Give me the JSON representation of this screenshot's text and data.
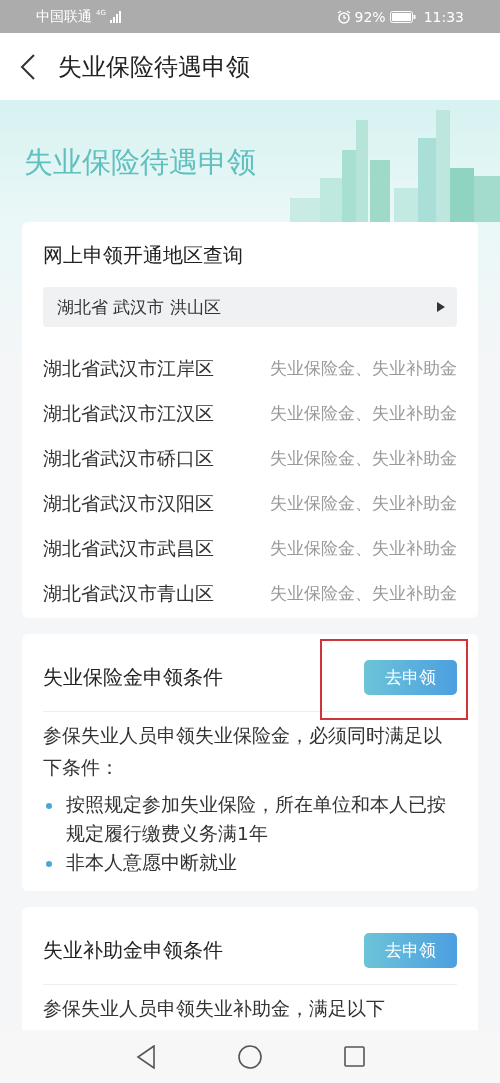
{
  "status_bar": {
    "carrier": "中国联通",
    "network": "4G",
    "battery": "92%",
    "time": "11:33"
  },
  "header": {
    "title": "失业保险待遇申领"
  },
  "banner": {
    "title": "失业保险待遇申领"
  },
  "region_card": {
    "title": "网上申领开通地区查询",
    "selector": "湖北省 武汉市 洪山区",
    "rows": [
      {
        "region": "湖北省武汉市江岸区",
        "benefits": "失业保险金、失业补助金"
      },
      {
        "region": "湖北省武汉市江汉区",
        "benefits": "失业保险金、失业补助金"
      },
      {
        "region": "湖北省武汉市硚口区",
        "benefits": "失业保险金、失业补助金"
      },
      {
        "region": "湖北省武汉市汉阳区",
        "benefits": "失业保险金、失业补助金"
      },
      {
        "region": "湖北省武汉市武昌区",
        "benefits": "失业保险金、失业补助金"
      },
      {
        "region": "湖北省武汉市青山区",
        "benefits": "失业保险金、失业补助金"
      }
    ]
  },
  "conditions": [
    {
      "title": "失业保险金申领条件",
      "button": "去申领",
      "highlighted": true,
      "intro": "参保失业人员申领失业保险金，必须同时满足以下条件：",
      "bullets": [
        "按照规定参加失业保险，所在单位和本人已按规定履行缴费义务满1年",
        "非本人意愿中断就业"
      ]
    },
    {
      "title": "失业补助金申领条件",
      "button": "去申领",
      "highlighted": false,
      "intro": "参保失业人员申领失业补助金，满足以下"
    }
  ]
}
